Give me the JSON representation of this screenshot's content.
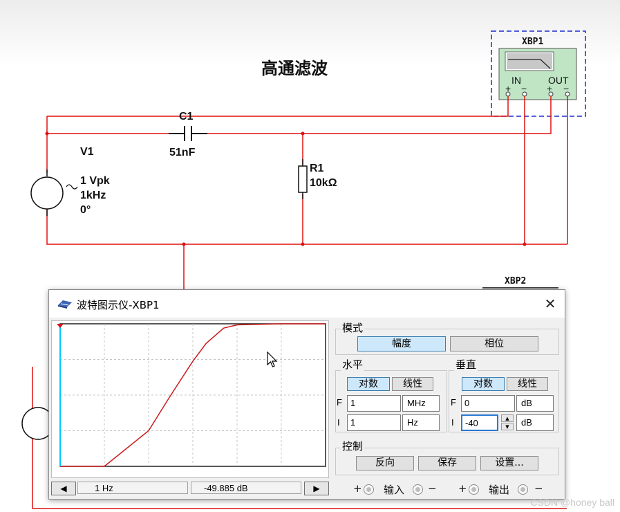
{
  "schematic": {
    "title": "高通滤波",
    "source": {
      "name": "V1",
      "amplitude": "1 Vpk",
      "frequency": "1kHz",
      "phase": "0°"
    },
    "capacitor": {
      "name": "C1",
      "value": "51nF"
    },
    "resistor": {
      "name": "R1",
      "value": "10kΩ"
    },
    "plotter1": {
      "name": "XBP1",
      "in_label": "IN",
      "out_label": "OUT",
      "plus": "+",
      "minus": "−"
    },
    "plotter2": {
      "name": "XBP2"
    },
    "wire_color": "#e01010"
  },
  "dialog": {
    "title": "波特图示仪-XBP1",
    "close_label": "✕",
    "mode": {
      "label": "模式",
      "magnitude": "幅度",
      "phase": "相位",
      "active": "magnitude"
    },
    "horizontal": {
      "label": "水平",
      "log": "对数",
      "linear": "线性",
      "final_label": "F",
      "final_value": "1",
      "final_unit": "MHz",
      "initial_label": "I",
      "initial_value": "1",
      "initial_unit": "Hz"
    },
    "vertical": {
      "label": "垂直",
      "log": "对数",
      "linear": "线性",
      "final_label": "F",
      "final_value": "0",
      "final_unit": "dB",
      "initial_label": "I",
      "initial_value": "-40",
      "initial_unit": "dB"
    },
    "control": {
      "label": "控制",
      "reverse": "反向",
      "save": "保存",
      "settings": "设置..."
    },
    "cursor": {
      "freq": "1 Hz",
      "mag": "-49.885 dB",
      "left_icon": "arrow-left-icon",
      "right_icon": "arrow-right-icon"
    },
    "io": {
      "input": "输入",
      "output": "输出",
      "plus": "+",
      "minus": "−"
    }
  },
  "chart_data": {
    "type": "line",
    "x_scale": "log",
    "xlim": [
      1,
      1000000
    ],
    "ylim": [
      -40,
      0
    ],
    "grid": true,
    "series": [
      {
        "x": [
          1,
          10,
          100,
          300,
          1000,
          2000,
          5000,
          10000,
          100000,
          1000000
        ],
        "y": [
          -40,
          -40,
          -30,
          -20.5,
          -10.5,
          -5.5,
          -1.2,
          -0.3,
          0,
          0
        ]
      }
    ],
    "cursor_x": 1,
    "trace_color": "#cc1a1a",
    "cursor_color": "#00c8ff"
  },
  "watermark": "CSDN @honey ball"
}
